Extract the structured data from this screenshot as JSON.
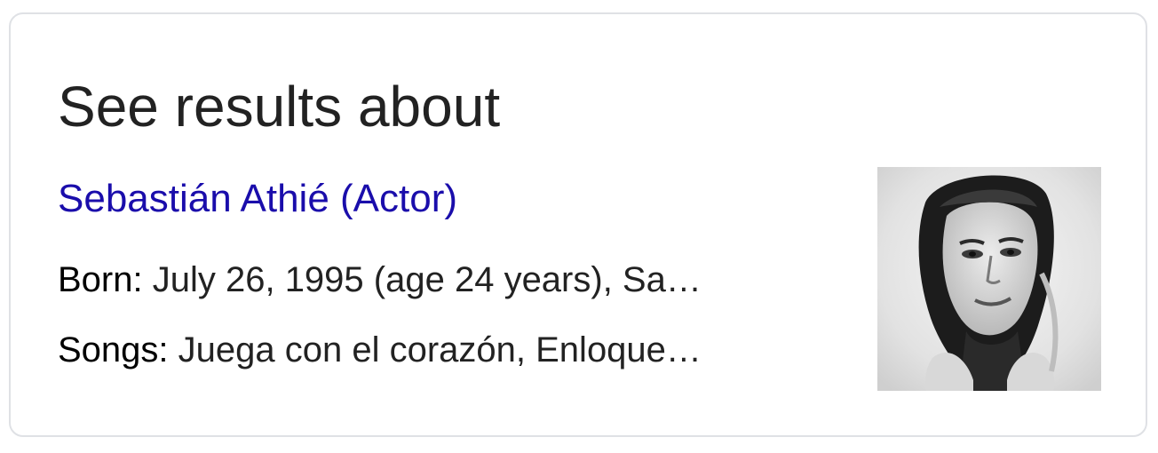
{
  "panel": {
    "heading": "See results about",
    "entity": {
      "title": "Sebastián Athié (Actor)",
      "facts": [
        {
          "label": "Born:",
          "value": " July 26, 1995 (age 24 years), Sa…"
        },
        {
          "label": "Songs:",
          "value": " Juega con el corazón, Enloque…"
        }
      ],
      "thumbnail_icon": "person-portrait-photo"
    }
  }
}
